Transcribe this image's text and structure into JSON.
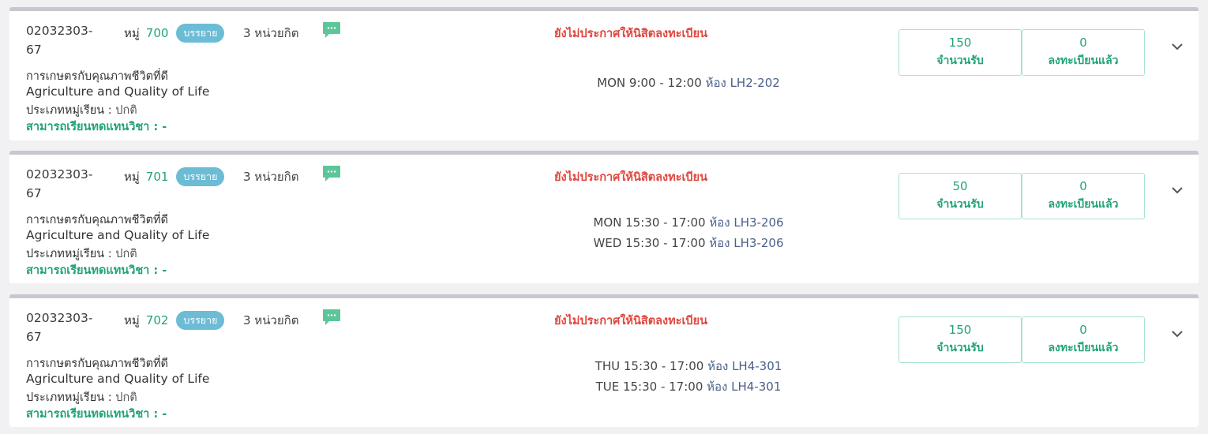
{
  "sections": [
    {
      "code_line1": "02032303-",
      "code_line2": "67",
      "section_prefix": "หมู่",
      "section_number": "700",
      "type_badge": "บรรยาย",
      "credit": "3 หน่วยกิต",
      "status": "ยังไม่ประกาศให้นิสิตลงทะเบียน",
      "name_th": "การเกษตรกับคุณภาพชีวิตที่ดี",
      "name_en": "Agriculture and Quality of Life",
      "section_type_label": "ประเภทหมู่เรียน :",
      "section_type_value": "ปกติ",
      "substitute": "สามารถเรียนทดแทนวิชา : -",
      "schedule": [
        {
          "time": "MON 9:00 - 12:00",
          "room_label": "ห้อง",
          "room": "LH2-202"
        }
      ],
      "capacity": "150",
      "capacity_label": "จำนวนรับ",
      "enrolled": "0",
      "enrolled_label": "ลงทะเบียนแล้ว"
    },
    {
      "code_line1": "02032303-",
      "code_line2": "67",
      "section_prefix": "หมู่",
      "section_number": "701",
      "type_badge": "บรรยาย",
      "credit": "3 หน่วยกิต",
      "status": "ยังไม่ประกาศให้นิสิตลงทะเบียน",
      "name_th": "การเกษตรกับคุณภาพชีวิตที่ดี",
      "name_en": "Agriculture and Quality of Life",
      "section_type_label": "ประเภทหมู่เรียน :",
      "section_type_value": "ปกติ",
      "substitute": "สามารถเรียนทดแทนวิชา : -",
      "schedule": [
        {
          "time": "MON 15:30 - 17:00",
          "room_label": "ห้อง",
          "room": "LH3-206"
        },
        {
          "time": "WED 15:30 - 17:00",
          "room_label": "ห้อง",
          "room": "LH3-206"
        }
      ],
      "capacity": "50",
      "capacity_label": "จำนวนรับ",
      "enrolled": "0",
      "enrolled_label": "ลงทะเบียนแล้ว"
    },
    {
      "code_line1": "02032303-",
      "code_line2": "67",
      "section_prefix": "หมู่",
      "section_number": "702",
      "type_badge": "บรรยาย",
      "credit": "3 หน่วยกิต",
      "status": "ยังไม่ประกาศให้นิสิตลงทะเบียน",
      "name_th": "การเกษตรกับคุณภาพชีวิตที่ดี",
      "name_en": "Agriculture and Quality of Life",
      "section_type_label": "ประเภทหมู่เรียน :",
      "section_type_value": "ปกติ",
      "substitute": "สามารถเรียนทดแทนวิชา : -",
      "schedule": [
        {
          "time": "THU 15:30 - 17:00",
          "room_label": "ห้อง",
          "room": "LH4-301"
        },
        {
          "time": "TUE 15:30 - 17:00",
          "room_label": "ห้อง",
          "room": "LH4-301"
        }
      ],
      "capacity": "150",
      "capacity_label": "จำนวนรับ",
      "enrolled": "0",
      "enrolled_label": "ลงทะเบียนแล้ว"
    }
  ],
  "icons": {
    "chat": "chat-bubble-icon",
    "expand": "chevron-down-icon"
  },
  "colors": {
    "accent_green": "#22a27a",
    "status_red": "#e0473f",
    "badge_blue": "#6cbcd6",
    "card_border": "#c7c7d1",
    "page_bg": "#f1f1f3"
  }
}
